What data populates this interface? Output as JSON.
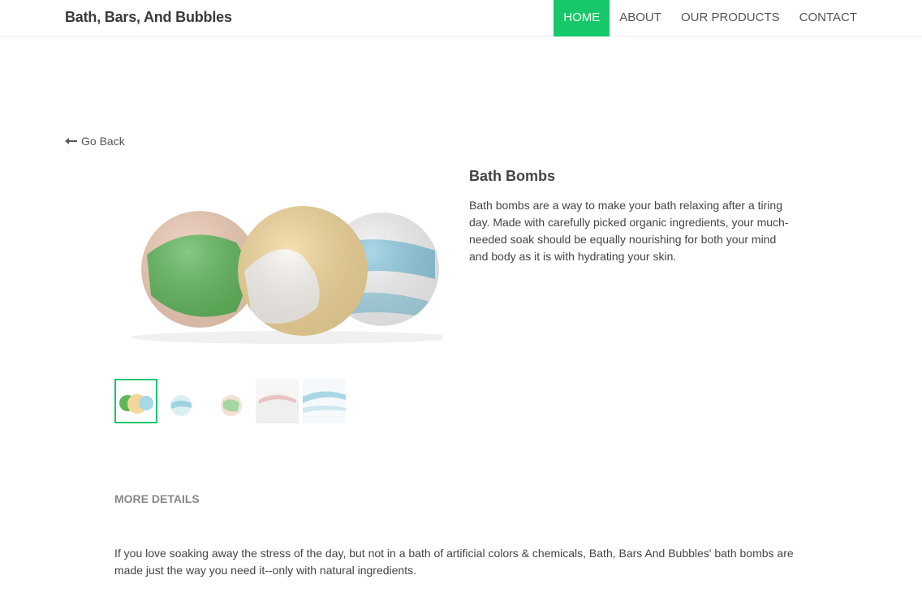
{
  "brand": {
    "name": "Bath, Bars, And Bubbles"
  },
  "nav": {
    "items": [
      {
        "label": "HOME",
        "active": true
      },
      {
        "label": "ABOUT",
        "active": false
      },
      {
        "label": "OUR PRODUCTS",
        "active": false
      },
      {
        "label": "CONTACT",
        "active": false
      }
    ]
  },
  "colors": {
    "accent": "#17c86a",
    "text": "#444444",
    "muted": "#888888"
  },
  "go_back": {
    "icon": "long-arrow-left-icon",
    "label": "Go Back"
  },
  "product": {
    "title": "Bath Bombs",
    "description": "Bath bombs are a way to make your bath relaxing after a tiring day. Made with carefully picked organic ingredients, your much-needed soak should be equally nourishing for both your mind and body as it is with hydrating your skin."
  },
  "gallery": {
    "thumbnail_count": 5,
    "selected_index": 0
  },
  "details": {
    "heading": "MORE DETAILS",
    "text": "If you love soaking away the stress of the day, but not in a bath of artificial colors & chemicals, Bath, Bars And Bubbles' bath bombs are made just the way you need it--only with natural ingredients."
  }
}
